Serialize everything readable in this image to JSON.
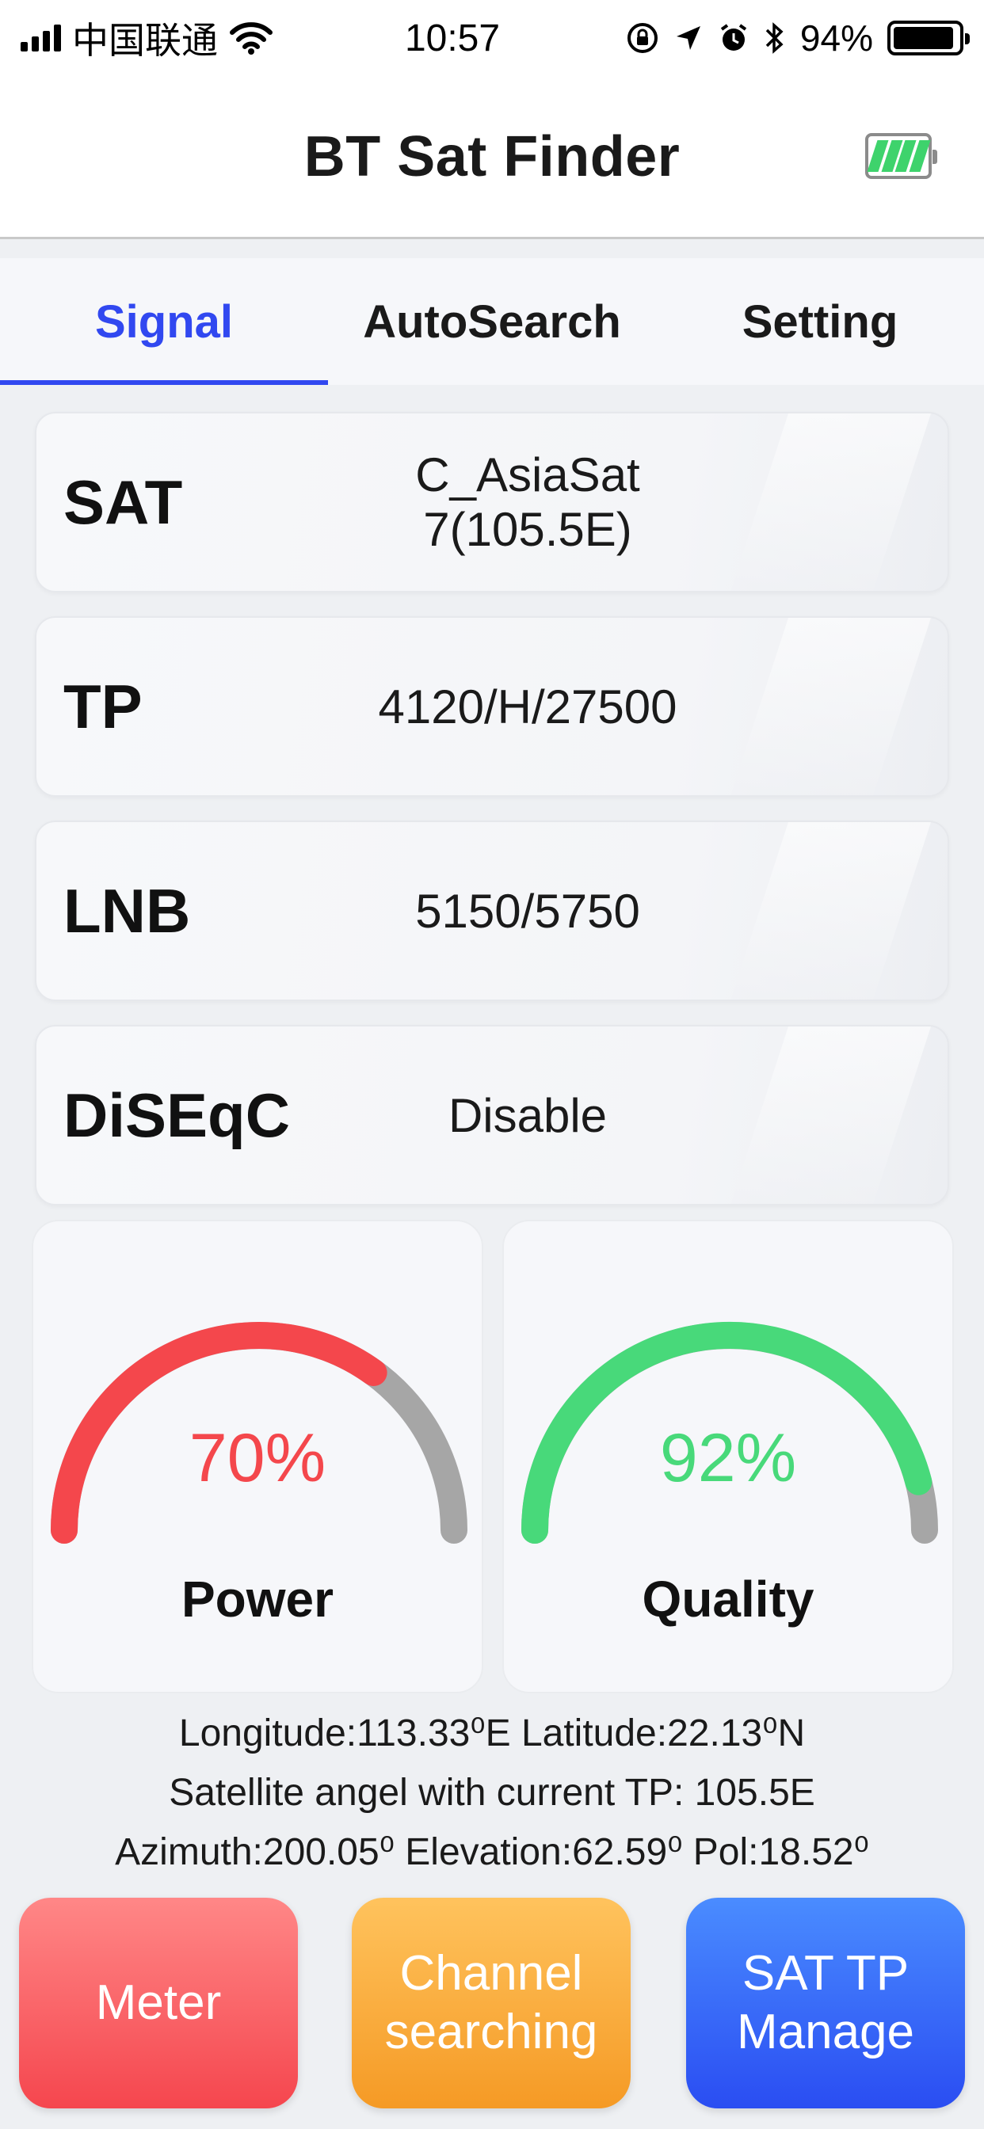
{
  "status_bar": {
    "carrier": "中国联通",
    "time": "10:57",
    "battery_percent": "94%"
  },
  "header": {
    "title": "BT Sat Finder"
  },
  "tabs": [
    {
      "label": "Signal",
      "active": true
    },
    {
      "label": "AutoSearch",
      "active": false
    },
    {
      "label": "Setting",
      "active": false
    }
  ],
  "info": [
    {
      "label": "SAT",
      "value": "C_AsiaSat 7(105.5E)"
    },
    {
      "label": "TP",
      "value": "4120/H/27500"
    },
    {
      "label": "LNB",
      "value": "5150/5750"
    },
    {
      "label": "DiSEqC",
      "value": "Disable"
    }
  ],
  "gauges": {
    "power": {
      "percent_text": "70%",
      "value": 70,
      "label": "Power",
      "color": "#f4474c"
    },
    "quality": {
      "percent_text": "92%",
      "value": 92,
      "label": "Quality",
      "color": "#48d97a"
    },
    "track_color": "#a6a6a6"
  },
  "location": {
    "coords": "Longitude:113.33⁰E   Latitude:22.13⁰N",
    "sat_angle": "Satellite angel with current TP: 105.5E",
    "pointing": "Azimuth:200.05⁰   Elevation:62.59⁰   Pol:18.52⁰"
  },
  "buttons": {
    "meter": {
      "line1": "Meter"
    },
    "channel": {
      "line1": "Channel",
      "line2": "searching"
    },
    "sattp": {
      "line1": "SAT TP",
      "line2": "Manage"
    }
  }
}
